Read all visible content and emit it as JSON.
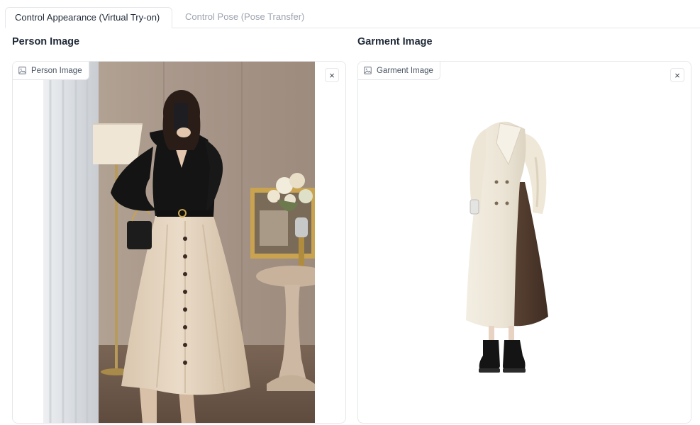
{
  "tabs": [
    {
      "label": "Control Appearance (Virtual Try-on)",
      "active": true
    },
    {
      "label": "Control Pose (Pose Transfer)",
      "active": false
    }
  ],
  "person_section": {
    "title": "Person Image",
    "panel_label": "Person Image",
    "label_icon": "image-icon",
    "close_symbol": "×",
    "photo_description_icon": "person-photo"
  },
  "garment_section": {
    "title": "Garment Image",
    "panel_label": "Garment Image",
    "label_icon": "image-icon",
    "close_symbol": "×",
    "photo_description_icon": "garment-photo"
  },
  "colors": {
    "border": "#e5e7eb",
    "text": "#1f2937",
    "muted": "#9ca3af"
  }
}
